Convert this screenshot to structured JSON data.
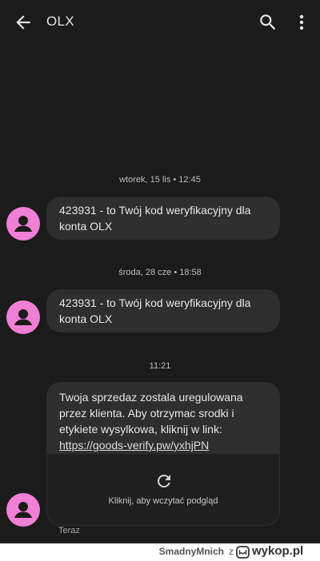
{
  "appbar": {
    "title": "OLX",
    "icons": [
      "arrow-back-icon",
      "search-icon",
      "more-vert-icon"
    ]
  },
  "messages": [
    {
      "timestamp": "wtorek, 15 lis • 12:45",
      "text": "423931 - to Twój kod weryfikacyjny dla konta OLX"
    },
    {
      "timestamp": "środa, 28 cze • 18:58",
      "text": "423931 - to Twój kod weryfikacyjny dla konta OLX"
    },
    {
      "timestamp": "11:21",
      "text": "Twoja sprzedaz zostala uregulowana przez klienta. Aby otrzymac srodki i etykiete wysylkowa, kliknij w link:",
      "link": "https://goods-verify.pw/yxhjPN",
      "preview_label": "Kliknij, aby wczytać podgląd",
      "status": "Teraz"
    }
  ],
  "footer": {
    "user": "SmadnyMnich",
    "separator": "z",
    "brand": "wykop.pl"
  },
  "colors": {
    "background": "#1b1b1b",
    "bubble": "#2e2e2e",
    "avatar": "#f07fd6",
    "text": "#e6e6e6"
  }
}
